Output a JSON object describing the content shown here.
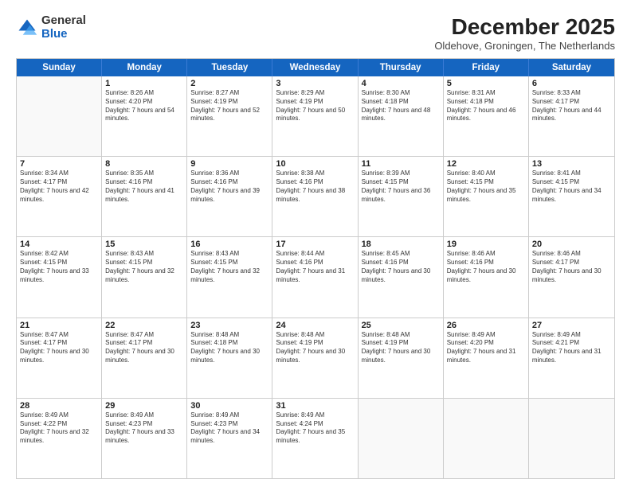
{
  "logo": {
    "general": "General",
    "blue": "Blue"
  },
  "title": "December 2025",
  "location": "Oldehove, Groningen, The Netherlands",
  "weekdays": [
    "Sunday",
    "Monday",
    "Tuesday",
    "Wednesday",
    "Thursday",
    "Friday",
    "Saturday"
  ],
  "rows": [
    [
      {
        "day": "",
        "sunrise": "",
        "sunset": "",
        "daylight": ""
      },
      {
        "day": "1",
        "sunrise": "Sunrise: 8:26 AM",
        "sunset": "Sunset: 4:20 PM",
        "daylight": "Daylight: 7 hours and 54 minutes."
      },
      {
        "day": "2",
        "sunrise": "Sunrise: 8:27 AM",
        "sunset": "Sunset: 4:19 PM",
        "daylight": "Daylight: 7 hours and 52 minutes."
      },
      {
        "day": "3",
        "sunrise": "Sunrise: 8:29 AM",
        "sunset": "Sunset: 4:19 PM",
        "daylight": "Daylight: 7 hours and 50 minutes."
      },
      {
        "day": "4",
        "sunrise": "Sunrise: 8:30 AM",
        "sunset": "Sunset: 4:18 PM",
        "daylight": "Daylight: 7 hours and 48 minutes."
      },
      {
        "day": "5",
        "sunrise": "Sunrise: 8:31 AM",
        "sunset": "Sunset: 4:18 PM",
        "daylight": "Daylight: 7 hours and 46 minutes."
      },
      {
        "day": "6",
        "sunrise": "Sunrise: 8:33 AM",
        "sunset": "Sunset: 4:17 PM",
        "daylight": "Daylight: 7 hours and 44 minutes."
      }
    ],
    [
      {
        "day": "7",
        "sunrise": "Sunrise: 8:34 AM",
        "sunset": "Sunset: 4:17 PM",
        "daylight": "Daylight: 7 hours and 42 minutes."
      },
      {
        "day": "8",
        "sunrise": "Sunrise: 8:35 AM",
        "sunset": "Sunset: 4:16 PM",
        "daylight": "Daylight: 7 hours and 41 minutes."
      },
      {
        "day": "9",
        "sunrise": "Sunrise: 8:36 AM",
        "sunset": "Sunset: 4:16 PM",
        "daylight": "Daylight: 7 hours and 39 minutes."
      },
      {
        "day": "10",
        "sunrise": "Sunrise: 8:38 AM",
        "sunset": "Sunset: 4:16 PM",
        "daylight": "Daylight: 7 hours and 38 minutes."
      },
      {
        "day": "11",
        "sunrise": "Sunrise: 8:39 AM",
        "sunset": "Sunset: 4:15 PM",
        "daylight": "Daylight: 7 hours and 36 minutes."
      },
      {
        "day": "12",
        "sunrise": "Sunrise: 8:40 AM",
        "sunset": "Sunset: 4:15 PM",
        "daylight": "Daylight: 7 hours and 35 minutes."
      },
      {
        "day": "13",
        "sunrise": "Sunrise: 8:41 AM",
        "sunset": "Sunset: 4:15 PM",
        "daylight": "Daylight: 7 hours and 34 minutes."
      }
    ],
    [
      {
        "day": "14",
        "sunrise": "Sunrise: 8:42 AM",
        "sunset": "Sunset: 4:15 PM",
        "daylight": "Daylight: 7 hours and 33 minutes."
      },
      {
        "day": "15",
        "sunrise": "Sunrise: 8:43 AM",
        "sunset": "Sunset: 4:15 PM",
        "daylight": "Daylight: 7 hours and 32 minutes."
      },
      {
        "day": "16",
        "sunrise": "Sunrise: 8:43 AM",
        "sunset": "Sunset: 4:15 PM",
        "daylight": "Daylight: 7 hours and 32 minutes."
      },
      {
        "day": "17",
        "sunrise": "Sunrise: 8:44 AM",
        "sunset": "Sunset: 4:16 PM",
        "daylight": "Daylight: 7 hours and 31 minutes."
      },
      {
        "day": "18",
        "sunrise": "Sunrise: 8:45 AM",
        "sunset": "Sunset: 4:16 PM",
        "daylight": "Daylight: 7 hours and 30 minutes."
      },
      {
        "day": "19",
        "sunrise": "Sunrise: 8:46 AM",
        "sunset": "Sunset: 4:16 PM",
        "daylight": "Daylight: 7 hours and 30 minutes."
      },
      {
        "day": "20",
        "sunrise": "Sunrise: 8:46 AM",
        "sunset": "Sunset: 4:17 PM",
        "daylight": "Daylight: 7 hours and 30 minutes."
      }
    ],
    [
      {
        "day": "21",
        "sunrise": "Sunrise: 8:47 AM",
        "sunset": "Sunset: 4:17 PM",
        "daylight": "Daylight: 7 hours and 30 minutes."
      },
      {
        "day": "22",
        "sunrise": "Sunrise: 8:47 AM",
        "sunset": "Sunset: 4:17 PM",
        "daylight": "Daylight: 7 hours and 30 minutes."
      },
      {
        "day": "23",
        "sunrise": "Sunrise: 8:48 AM",
        "sunset": "Sunset: 4:18 PM",
        "daylight": "Daylight: 7 hours and 30 minutes."
      },
      {
        "day": "24",
        "sunrise": "Sunrise: 8:48 AM",
        "sunset": "Sunset: 4:19 PM",
        "daylight": "Daylight: 7 hours and 30 minutes."
      },
      {
        "day": "25",
        "sunrise": "Sunrise: 8:48 AM",
        "sunset": "Sunset: 4:19 PM",
        "daylight": "Daylight: 7 hours and 30 minutes."
      },
      {
        "day": "26",
        "sunrise": "Sunrise: 8:49 AM",
        "sunset": "Sunset: 4:20 PM",
        "daylight": "Daylight: 7 hours and 31 minutes."
      },
      {
        "day": "27",
        "sunrise": "Sunrise: 8:49 AM",
        "sunset": "Sunset: 4:21 PM",
        "daylight": "Daylight: 7 hours and 31 minutes."
      }
    ],
    [
      {
        "day": "28",
        "sunrise": "Sunrise: 8:49 AM",
        "sunset": "Sunset: 4:22 PM",
        "daylight": "Daylight: 7 hours and 32 minutes."
      },
      {
        "day": "29",
        "sunrise": "Sunrise: 8:49 AM",
        "sunset": "Sunset: 4:23 PM",
        "daylight": "Daylight: 7 hours and 33 minutes."
      },
      {
        "day": "30",
        "sunrise": "Sunrise: 8:49 AM",
        "sunset": "Sunset: 4:23 PM",
        "daylight": "Daylight: 7 hours and 34 minutes."
      },
      {
        "day": "31",
        "sunrise": "Sunrise: 8:49 AM",
        "sunset": "Sunset: 4:24 PM",
        "daylight": "Daylight: 7 hours and 35 minutes."
      },
      {
        "day": "",
        "sunrise": "",
        "sunset": "",
        "daylight": ""
      },
      {
        "day": "",
        "sunrise": "",
        "sunset": "",
        "daylight": ""
      },
      {
        "day": "",
        "sunrise": "",
        "sunset": "",
        "daylight": ""
      }
    ]
  ]
}
